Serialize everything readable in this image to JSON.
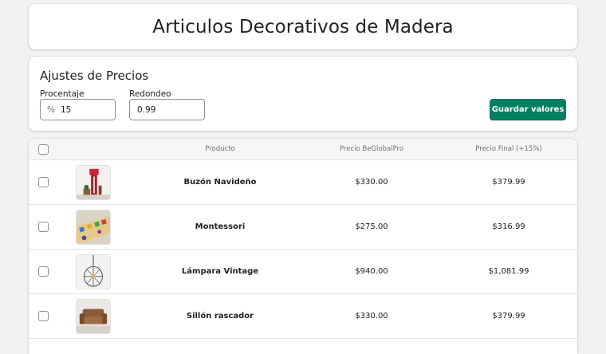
{
  "header": {
    "title": "Articulos Decorativos de Madera"
  },
  "settings": {
    "title": "Ajustes de Precios",
    "percentage_label": "Procentaje",
    "percentage_prefix": "%",
    "percentage_value": "15",
    "rounding_label": "Redondeo",
    "rounding_value": "0.99",
    "save_label": "Guardar valores"
  },
  "table": {
    "columns": {
      "product": "Producto",
      "base_price": "Precio BeGlobalPro",
      "final_price": "Precio Final (+15%)"
    },
    "rows": [
      {
        "name": "Buzón Navideño",
        "base_price": "$330.00",
        "final_price": "$379.99",
        "thumb_icon": "mailbox-image"
      },
      {
        "name": "Montessori",
        "base_price": "$275.00",
        "final_price": "$316.99",
        "thumb_icon": "montessori-toy-image"
      },
      {
        "name": "Lámpara Vintage",
        "base_price": "$940.00",
        "final_price": "$1,081.99",
        "thumb_icon": "lamp-image"
      },
      {
        "name": "Sillón rascador",
        "base_price": "$330.00",
        "final_price": "$379.99",
        "thumb_icon": "armchair-image"
      }
    ]
  },
  "colors": {
    "primary": "#008060",
    "background": "#f1f2f4",
    "border": "#e1e3e5"
  }
}
